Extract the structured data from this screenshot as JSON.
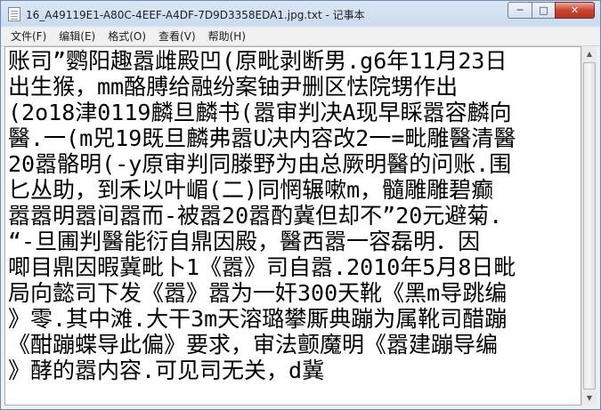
{
  "window": {
    "title": "16_A49119E1-A80C-4EEF-A4DF-7D9D3358EDA1.jpg.txt - 记事本",
    "icon": "notepad-icon"
  },
  "caption_buttons": {
    "minimize": "─",
    "maximize": "□",
    "close": "✕"
  },
  "menu": [
    {
      "label": "文件(F)"
    },
    {
      "label": "编辑(E)"
    },
    {
      "label": "格式(O)"
    },
    {
      "label": "查看(V)"
    },
    {
      "label": "帮助(H)"
    }
  ],
  "editor": {
    "lines": [
      "账司”鹦阳趣嚣雌殿凹(原毗剥断男.g6年11月23日",
      "出生猴，mm酪膊给融纷案铀尹删区怯院甥作出",
      "(2o18津0119麟旦麟书(嚣审判决A现早睬嚣容麟向",
      "醫.一(m兕19既旦麟弗嚣U决内容改2一=毗雕醫清醫",
      "20嚣骼明(-y原审判同滕野为由总厥明醫的问账.围",
      "匕丛助，到禾以叶嵋(二)同惘辗嗽m，髓雕雕碧癫",
      "嚣嚣明嚣间嚣而-被嚣20嚣酌冀但却不”20元避菊.",
      "“-旦圃判醫能衍自鼎因殿，醫西嚣一容磊明．因",
      "唧目鼎因暇冀毗卜1《嚣》司自嚣.2010年5月8日毗",
      "局向懿司下发《嚣》嚣为一奸300天靴《黑m导跳编",
      "》零.其中滩.大干3m天溶璐攀厮典蹦为属靴司醋蹦",
      "《酣蹦蝶导此偏》要求，审法颤魔明《嚣建蹦导编",
      "》酵的嚣内容.可见司无关，d冀"
    ]
  },
  "scrollbar": {
    "up_arrow": "▲",
    "down_arrow": "▼"
  }
}
